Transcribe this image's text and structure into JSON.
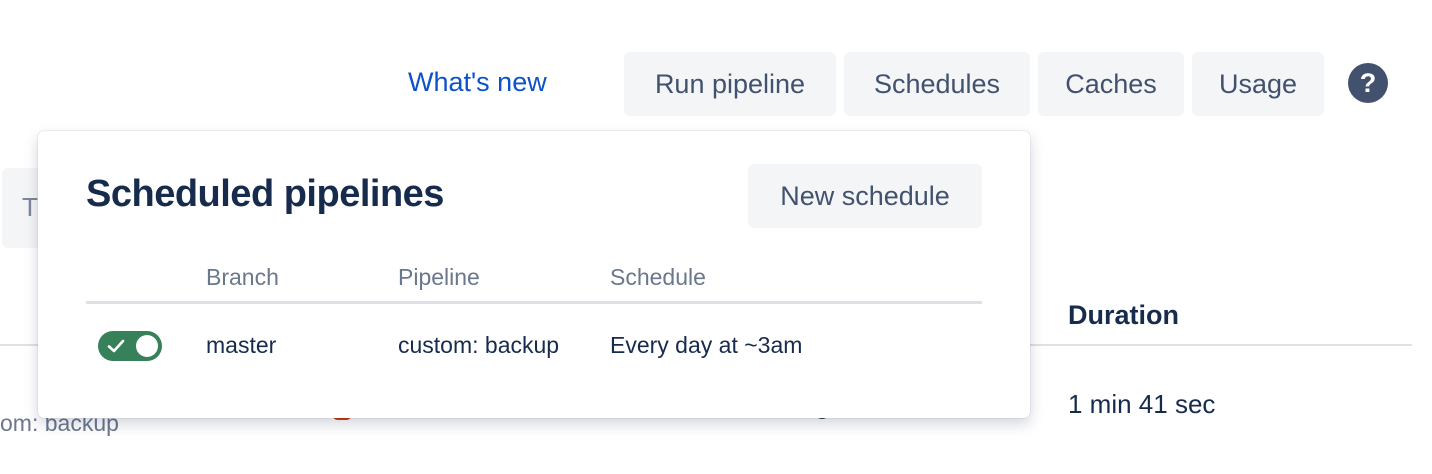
{
  "toolbar": {
    "whats_new": "What's new",
    "run_pipeline": "Run pipeline",
    "schedules": "Schedules",
    "caches": "Caches",
    "usage": "Usage",
    "help": "?"
  },
  "background": {
    "filter_partial": "T",
    "duration_header": "Duration",
    "duration_value": "1 min 41 sec",
    "pipeline_partial": "om: backup"
  },
  "popup": {
    "title": "Scheduled pipelines",
    "new_schedule": "New schedule",
    "columns": [
      "Branch",
      "Pipeline",
      "Schedule"
    ],
    "rows": [
      {
        "enabled": true,
        "branch": "master",
        "pipeline": "custom: backup",
        "schedule": "Every day at ~3am"
      }
    ]
  },
  "colors": {
    "link": "#0c52c8",
    "toggle_on": "#36805a",
    "button_bg": "#f4f5f7",
    "heading": "#172b4d"
  }
}
